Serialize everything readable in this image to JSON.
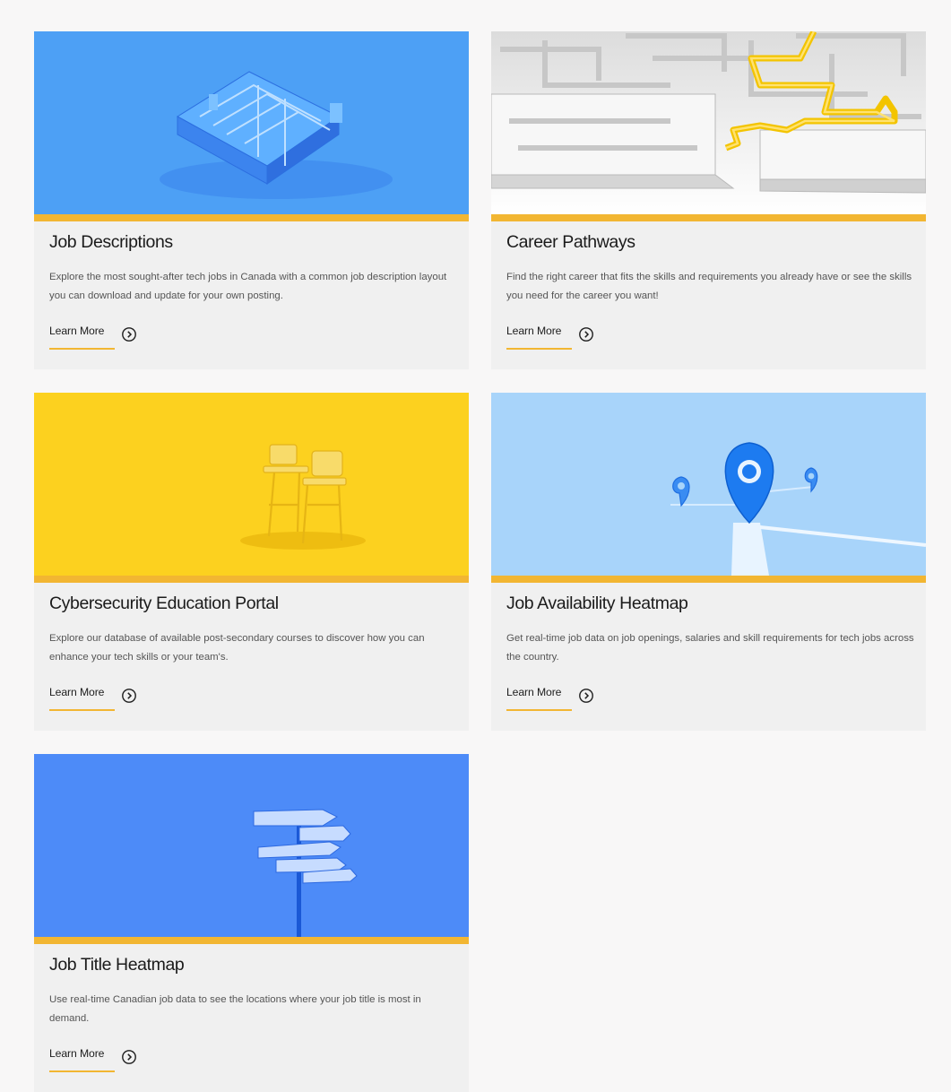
{
  "cards": [
    {
      "title": "Job Descriptions",
      "description": "Explore the most sought-after tech jobs in Canada with a common job description layout you can download and update for your own posting.",
      "link_label": "Learn More",
      "image": "blue-office-cubicles-image",
      "image_bg": "#4da0f5"
    },
    {
      "title": "Career Pathways",
      "description": "Find the right career that fits the skills and requirements you already have or see the skills you need for the career you want!",
      "link_label": "Learn More",
      "image": "maze-with-yellow-path-image",
      "image_bg": "#e9e9e9"
    },
    {
      "title": "Cybersecurity Education Portal",
      "description": "Explore our database of available post-secondary courses to discover how you can enhance your tech skills or your team's.",
      "link_label": "Learn More",
      "image": "yellow-school-desk-image",
      "image_bg": "#fcd11f"
    },
    {
      "title": "Job Availability Heatmap",
      "description": "Get real-time job data on job openings, salaries and skill requirements for tech jobs across the country.",
      "link_label": "Learn More",
      "image": "blue-map-pins-image",
      "image_bg": "#a8d4fa"
    },
    {
      "title": "Job Title Heatmap",
      "description": "Use real-time Canadian job data to see the locations where your job title is most in demand.",
      "link_label": "Learn More",
      "image": "blue-signpost-image",
      "image_bg": "#4d8bf8"
    }
  ],
  "colors": {
    "accent": "#f2b632",
    "card_bg": "#f0f0f0",
    "page_bg": "#f8f7f7"
  }
}
